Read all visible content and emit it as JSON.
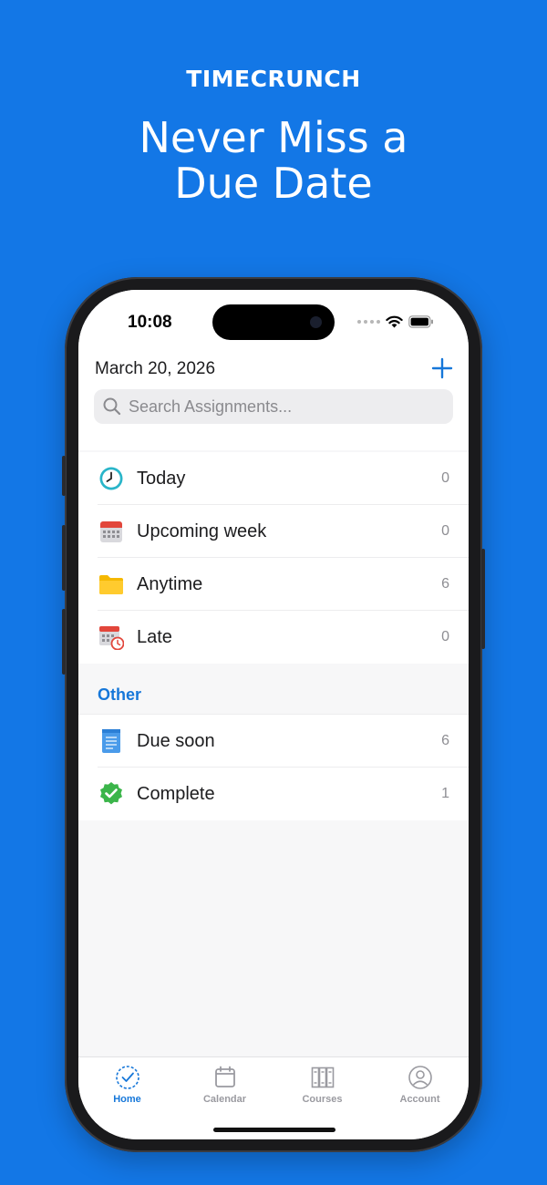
{
  "marketing": {
    "brand": "TIMECRUNCH",
    "headline_line1": "Never Miss a",
    "headline_line2": "Due Date"
  },
  "status_bar": {
    "time": "10:08"
  },
  "header": {
    "date": "March 20, 2026",
    "add_icon": "plus-icon"
  },
  "search": {
    "placeholder": "Search Assignments..."
  },
  "lists": {
    "main": [
      {
        "label": "Today",
        "count": "0",
        "icon": "clock-icon"
      },
      {
        "label": "Upcoming week",
        "count": "0",
        "icon": "calendar-icon"
      },
      {
        "label": "Anytime",
        "count": "6",
        "icon": "folder-icon"
      },
      {
        "label": "Late",
        "count": "0",
        "icon": "late-calendar-icon"
      }
    ],
    "other_title": "Other",
    "other": [
      {
        "label": "Due soon",
        "count": "6",
        "icon": "notepad-icon"
      },
      {
        "label": "Complete",
        "count": "1",
        "icon": "check-badge-icon"
      }
    ]
  },
  "tabbar": {
    "tabs": [
      {
        "label": "Home",
        "icon": "home-check-icon",
        "active": true
      },
      {
        "label": "Calendar",
        "icon": "calendar-outline-icon",
        "active": false
      },
      {
        "label": "Courses",
        "icon": "books-icon",
        "active": false
      },
      {
        "label": "Account",
        "icon": "person-icon",
        "active": false
      }
    ]
  },
  "colors": {
    "background": "#1377E6",
    "accent": "#1677D9",
    "text": "#1C1C1E",
    "muted": "#8E8E93"
  }
}
